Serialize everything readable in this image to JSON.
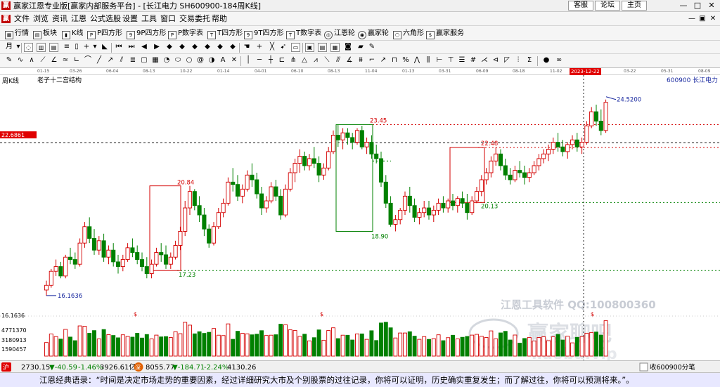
{
  "window": {
    "title": "赢家江恩专业版[赢家内部服务平台] - [长江电力  SH600900-184周K线]",
    "links": [
      "客服",
      "论坛",
      "主页"
    ],
    "icon": "app-logo-icon"
  },
  "menu": {
    "items": [
      "文件",
      "浏览",
      "资讯",
      "江恩",
      "公式选股",
      "设置",
      "工具",
      "窗口",
      "交易委托",
      "帮助"
    ]
  },
  "toolbar1": {
    "items": [
      {
        "label": "行情",
        "icon": "grid-icon"
      },
      {
        "label": "板块",
        "icon": "block-icon"
      },
      {
        "label": "K线",
        "icon": "kline-icon"
      },
      {
        "label": "P四方形",
        "icon": "p-square-icon"
      },
      {
        "label": "9P四方形",
        "icon": "9p-square-icon"
      },
      {
        "label": "P数字表",
        "icon": "p-table-icon"
      },
      {
        "label": "T四方形",
        "icon": "t-square-icon"
      },
      {
        "label": "9T四方形",
        "icon": "9t-square-icon"
      },
      {
        "label": "T数字表",
        "icon": "t-table-icon"
      },
      {
        "label": "江恩轮",
        "icon": "gann-wheel-icon"
      },
      {
        "label": "赢家轮",
        "icon": "winner-wheel-icon"
      },
      {
        "label": "六角形",
        "icon": "hexagon-icon"
      },
      {
        "label": "赢家服务",
        "icon": "service-icon"
      }
    ]
  },
  "chart_panel": {
    "period_label": "周K线",
    "structure_label": "老子十二宫结构",
    "stock_code": "600900",
    "stock_name": "长江电力",
    "price_marker": "22.6861",
    "low_marker": "16.1636",
    "cursor_date": "2023-12-22",
    "date_ticks": [
      "01-15",
      "03-26",
      "06-04",
      "08-13",
      "10-22",
      "01-14",
      "04-01",
      "06-10",
      "08-13",
      "11-04",
      "01-13",
      "03-31",
      "06-09",
      "08-18",
      "11-02",
      "03-22",
      "05-31",
      "08-09"
    ],
    "volume_ticks": [
      "4771370",
      "3180913",
      "1590457"
    ],
    "watermark": {
      "line1": "江恩工具软件  QQ:100800360",
      "line2": "赢家聊吧",
      "line3": "iiaoba.vip"
    }
  },
  "status_bar": {
    "sh_index": "2730.15",
    "sh_change": "▼-40.59",
    "sh_pct": "-1.46%",
    "sh_amount": "3926.61亿",
    "sz_index": "8055.77",
    "sz_change": "▼-184.71",
    "sz_pct": "-2.24%",
    "sz_amount": "4130.26",
    "right_text": "收600900分笔",
    "marquee_label": "沪",
    "sz_label": "深"
  },
  "quote_bar": {
    "text": "江恩经典语录：“时间是决定市场走势的重要因素，经过详细研究大市及个别股票的过往记录，你将可以证明，历史确实重复发生；而了解过往，你将可以预测将来。”。"
  },
  "colors": {
    "up": "#d40000",
    "down": "#008000",
    "accent_red": "#e00000",
    "marker_blue": "#1a2aa0"
  },
  "chart_data": {
    "type": "candlestick",
    "period": "weekly",
    "series_name": "长江电力",
    "y_range": [
      15.5,
      25.2
    ],
    "annotations": {
      "levels": [
        23.45,
        22.48,
        20.84,
        20.13,
        18.9,
        17.23,
        16.1636,
        24.52
      ],
      "boxes": [
        {
          "top": 20.84,
          "bottom": 17.23,
          "color": "#d40000"
        },
        {
          "top": 23.45,
          "bottom": 18.9,
          "color": "#008000"
        },
        {
          "top": 22.48,
          "bottom": 20.13,
          "color": "#d40000"
        }
      ],
      "price_line": 22.6861
    },
    "ohlc": [
      [
        16.4,
        16.8,
        16.16,
        16.6
      ],
      [
        16.6,
        17.3,
        16.5,
        17.2
      ],
      [
        17.2,
        17.7,
        17.0,
        17.4
      ],
      [
        17.4,
        17.6,
        16.9,
        17.0
      ],
      [
        17.0,
        17.9,
        16.9,
        17.8
      ],
      [
        17.8,
        18.2,
        17.5,
        17.7
      ],
      [
        17.7,
        18.0,
        17.3,
        17.5
      ],
      [
        17.5,
        18.6,
        17.4,
        18.4
      ],
      [
        18.4,
        19.3,
        18.2,
        19.1
      ],
      [
        19.1,
        19.5,
        18.4,
        18.6
      ],
      [
        18.6,
        19.0,
        17.9,
        18.1
      ],
      [
        18.1,
        18.7,
        17.9,
        18.5
      ],
      [
        18.5,
        18.8,
        17.6,
        17.8
      ],
      [
        17.8,
        18.3,
        17.5,
        18.1
      ],
      [
        18.1,
        18.4,
        17.4,
        17.6
      ],
      [
        17.6,
        17.9,
        17.1,
        17.4
      ],
      [
        17.4,
        17.9,
        17.2,
        17.7
      ],
      [
        17.7,
        18.4,
        17.6,
        18.2
      ],
      [
        18.2,
        18.6,
        17.8,
        18.0
      ],
      [
        18.0,
        18.3,
        17.5,
        17.7
      ],
      [
        17.7,
        18.0,
        17.2,
        17.4
      ],
      [
        17.4,
        17.8,
        16.9,
        17.1
      ],
      [
        17.1,
        17.7,
        16.9,
        17.5
      ],
      [
        17.5,
        18.2,
        17.4,
        18.0
      ],
      [
        18.0,
        18.4,
        17.6,
        17.9
      ],
      [
        17.9,
        18.3,
        17.3,
        17.5
      ],
      [
        17.5,
        18.0,
        17.3,
        17.8
      ],
      [
        17.8,
        18.5,
        17.7,
        18.3
      ],
      [
        18.3,
        19.1,
        18.1,
        18.9
      ],
      [
        18.9,
        20.2,
        18.7,
        19.9
      ],
      [
        19.9,
        20.84,
        19.6,
        20.6
      ],
      [
        20.6,
        20.7,
        19.8,
        20.0
      ],
      [
        20.0,
        20.4,
        19.3,
        19.6
      ],
      [
        19.6,
        19.9,
        18.7,
        19.0
      ],
      [
        19.0,
        19.2,
        18.2,
        18.4
      ],
      [
        18.4,
        19.3,
        18.3,
        19.1
      ],
      [
        19.1,
        19.9,
        19.0,
        19.7
      ],
      [
        19.7,
        20.3,
        19.5,
        20.1
      ],
      [
        20.1,
        21.2,
        20.0,
        21.0
      ],
      [
        21.0,
        21.6,
        20.6,
        20.9
      ],
      [
        20.9,
        21.3,
        20.2,
        20.4
      ],
      [
        20.4,
        20.9,
        20.1,
        20.7
      ],
      [
        20.7,
        21.5,
        20.6,
        21.3
      ],
      [
        21.3,
        21.8,
        20.8,
        21.1
      ],
      [
        21.1,
        21.4,
        20.3,
        20.5
      ],
      [
        20.5,
        20.8,
        19.6,
        19.9
      ],
      [
        19.9,
        20.4,
        19.7,
        20.2
      ],
      [
        20.2,
        21.0,
        20.1,
        20.8
      ],
      [
        20.8,
        21.1,
        20.2,
        20.4
      ],
      [
        20.4,
        20.7,
        19.4,
        19.6
      ],
      [
        19.6,
        20.9,
        19.5,
        20.7
      ],
      [
        20.7,
        21.6,
        20.6,
        21.4
      ],
      [
        21.4,
        22.0,
        21.0,
        21.8
      ],
      [
        21.8,
        22.4,
        21.4,
        22.1
      ],
      [
        22.1,
        22.3,
        21.5,
        21.7
      ],
      [
        21.7,
        22.2,
        21.5,
        22.0
      ],
      [
        22.0,
        22.5,
        21.6,
        21.8
      ],
      [
        21.8,
        22.1,
        21.0,
        21.3
      ],
      [
        21.3,
        21.8,
        21.1,
        21.6
      ],
      [
        21.6,
        22.5,
        21.5,
        22.3
      ],
      [
        22.3,
        23.2,
        22.2,
        23.0
      ],
      [
        23.0,
        23.45,
        22.5,
        22.8
      ],
      [
        22.8,
        23.3,
        22.4,
        23.1
      ],
      [
        23.1,
        23.3,
        22.6,
        22.9
      ],
      [
        22.9,
        23.1,
        22.4,
        22.7
      ],
      [
        22.7,
        23.3,
        22.6,
        23.2
      ],
      [
        23.2,
        23.4,
        22.4,
        22.5
      ],
      [
        22.5,
        22.9,
        22.2,
        22.7
      ],
      [
        22.7,
        23.0,
        22.0,
        22.2
      ],
      [
        22.2,
        22.6,
        21.8,
        22.0
      ],
      [
        22.0,
        22.3,
        20.8,
        21.0
      ],
      [
        21.0,
        21.3,
        19.9,
        20.1
      ],
      [
        20.1,
        20.4,
        19.1,
        19.2
      ],
      [
        19.2,
        19.6,
        18.9,
        19.4
      ],
      [
        19.4,
        19.9,
        19.2,
        19.8
      ],
      [
        19.8,
        20.6,
        19.6,
        20.4
      ],
      [
        20.4,
        20.8,
        19.7,
        20.0
      ],
      [
        20.0,
        20.3,
        19.3,
        19.5
      ],
      [
        19.5,
        19.9,
        19.2,
        19.7
      ],
      [
        19.7,
        20.2,
        19.5,
        19.9
      ],
      [
        19.9,
        20.2,
        19.4,
        19.6
      ],
      [
        19.6,
        20.0,
        19.3,
        19.8
      ],
      [
        19.8,
        20.3,
        19.6,
        20.1
      ],
      [
        20.1,
        20.4,
        19.7,
        19.9
      ],
      [
        19.9,
        20.3,
        19.7,
        20.2
      ],
      [
        20.2,
        20.5,
        19.8,
        20.0
      ],
      [
        20.0,
        20.4,
        19.7,
        20.3
      ],
      [
        20.3,
        20.6,
        19.9,
        20.1
      ],
      [
        20.1,
        20.5,
        19.4,
        19.7
      ],
      [
        19.7,
        20.4,
        19.6,
        20.2
      ],
      [
        20.2,
        20.8,
        20.1,
        20.6
      ],
      [
        20.6,
        21.3,
        20.4,
        21.1
      ],
      [
        21.1,
        21.6,
        20.9,
        21.4
      ],
      [
        21.4,
        22.1,
        21.2,
        21.9
      ],
      [
        21.9,
        22.48,
        21.7,
        22.2
      ],
      [
        22.2,
        22.4,
        21.5,
        21.7
      ],
      [
        21.7,
        22.0,
        21.1,
        21.3
      ],
      [
        21.3,
        21.6,
        20.9,
        21.1
      ],
      [
        21.1,
        21.7,
        21.0,
        21.5
      ],
      [
        21.5,
        21.9,
        21.2,
        21.4
      ],
      [
        21.4,
        21.7,
        20.9,
        21.2
      ],
      [
        21.2,
        21.6,
        21.0,
        21.4
      ],
      [
        21.4,
        21.9,
        21.3,
        21.7
      ],
      [
        21.7,
        22.2,
        21.5,
        22.0
      ],
      [
        22.0,
        22.4,
        21.8,
        22.2
      ],
      [
        22.2,
        22.6,
        21.9,
        22.4
      ],
      [
        22.4,
        22.9,
        22.2,
        22.7
      ],
      [
        22.7,
        23.1,
        22.3,
        22.5
      ],
      [
        22.5,
        22.8,
        22.1,
        22.3
      ],
      [
        22.3,
        22.7,
        22.0,
        22.6
      ],
      [
        22.6,
        23.0,
        22.4,
        22.8
      ],
      [
        22.8,
        23.1,
        22.3,
        22.5
      ],
      [
        22.5,
        22.9,
        22.2,
        22.7
      ],
      [
        22.7,
        23.6,
        22.6,
        23.4
      ],
      [
        23.4,
        24.2,
        23.3,
        24.0
      ],
      [
        24.0,
        24.3,
        23.4,
        23.6
      ],
      [
        23.6,
        24.1,
        23.0,
        23.2
      ],
      [
        23.2,
        24.52,
        23.1,
        24.4
      ]
    ],
    "volume_ticks": [
      4771370,
      3180913,
      1590457
    ],
    "ylabel": "",
    "xlabel": ""
  }
}
